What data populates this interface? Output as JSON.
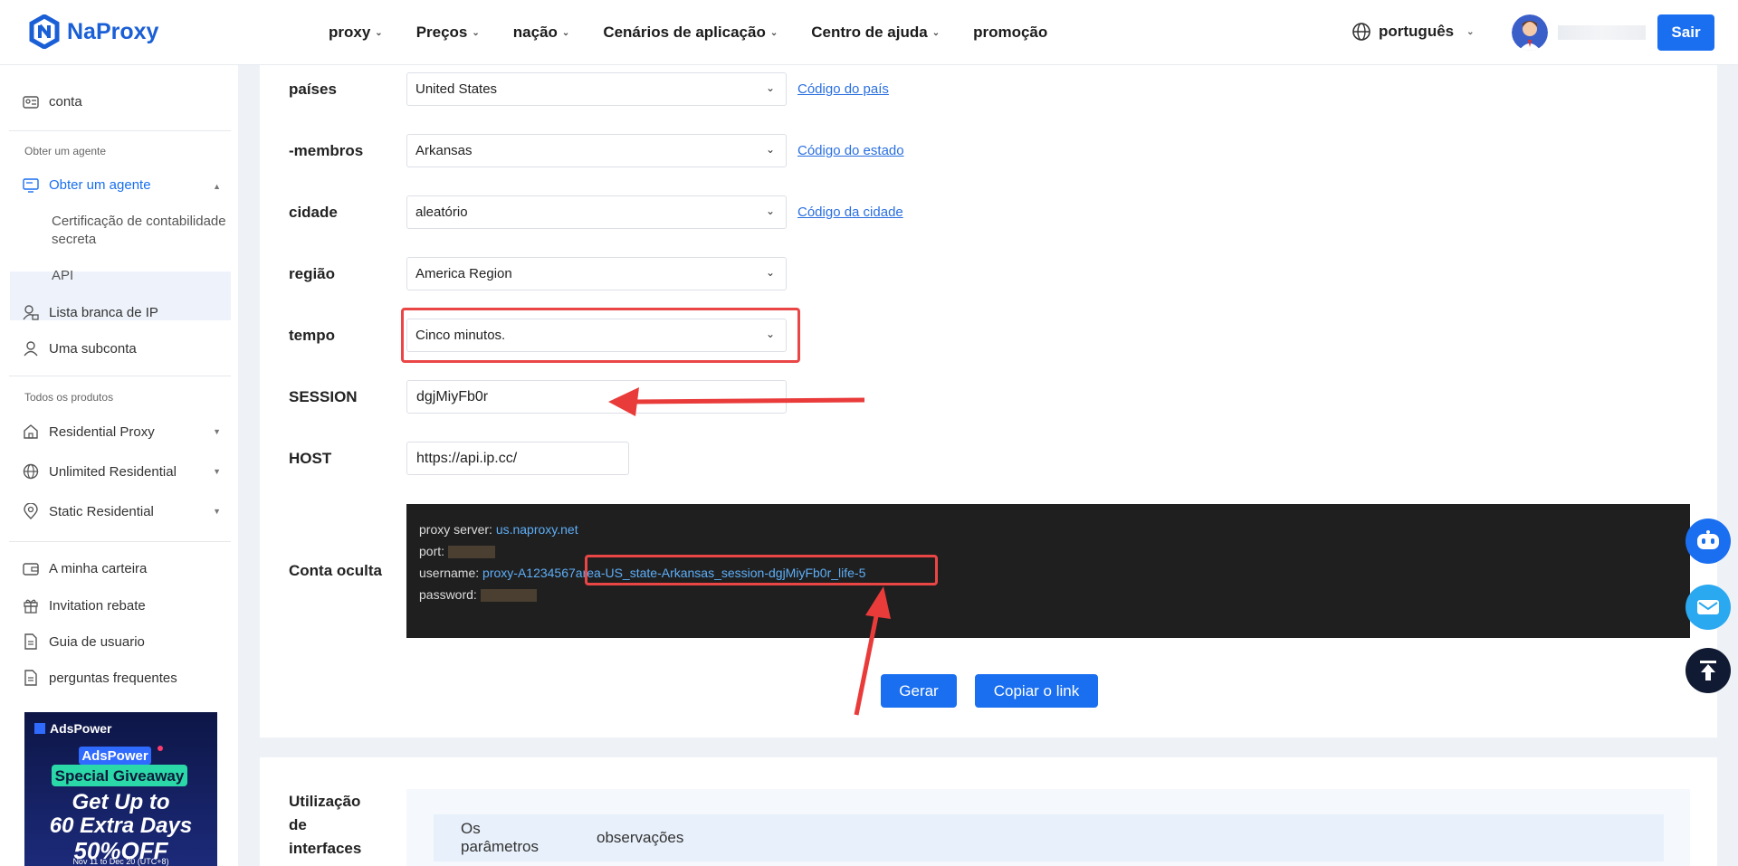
{
  "header": {
    "brand": "NaProxy",
    "nav": [
      "proxy",
      "Preços",
      "nação",
      "Cenários de aplicação",
      "Centro de ajuda",
      "promoção"
    ],
    "nav_has_dropdown": [
      true,
      true,
      true,
      true,
      true,
      false
    ],
    "language": "português",
    "logout_label": "Sair"
  },
  "sidebar": {
    "account": "conta",
    "section_agent": "Obter um agente",
    "agent_menu": "Obter um agente",
    "agent_sub_1": "Certificação de contabilidade secreta",
    "agent_sub_2": "API",
    "ip_whitelist": "Lista branca de IP",
    "subaccount": "Uma subconta",
    "section_products": "Todos os produtos",
    "products": [
      "Residential Proxy",
      "Unlimited Residential",
      "Static Residential"
    ],
    "wallet": "A minha carteira",
    "invitation": "Invitation rebate",
    "guide": "Guia de usuario",
    "faq": "perguntas frequentes"
  },
  "ad": {
    "brand": "AdsPower",
    "badge": "AdsPower",
    "giveaway": "Special Giveaway",
    "headline_1": "Get Up to",
    "headline_2": "60 Extra Days",
    "discount": "50%OFF",
    "dates": "Nov 11 to Dec 20 (UTC+8)"
  },
  "form": {
    "country_label": "países",
    "country_value": "United States",
    "country_link": "Código do país",
    "state_label": "-membros",
    "state_value": "Arkansas",
    "state_link": "Código do estado",
    "city_label": "cidade",
    "city_value": "aleatório",
    "city_link": "Código da cidade",
    "region_label": "região",
    "region_value": "America Region",
    "time_label": "tempo",
    "time_value": "Cinco minutos.",
    "session_label": "SESSION",
    "session_value": "dgjMiyFb0r",
    "host_label": "HOST",
    "host_value": "https://api.ip.cc/"
  },
  "hidden_account": {
    "label": "Conta oculta",
    "server_key": "proxy server:",
    "server_value": "us.naproxy.net",
    "port_key": "port:",
    "username_key": "username:",
    "username_prefix": "proxy-A1234567",
    "username_suffix": "area-US_state-Arkansas_session-dgjMiyFb0r_life-5",
    "password_key": "password:"
  },
  "actions": {
    "generate": "Gerar",
    "copy_link": "Copiar o link"
  },
  "usage": {
    "label_1": "Utilização",
    "label_2": "de",
    "label_3": "interfaces",
    "col_params_1": "Os",
    "col_params_2": "parâmetros",
    "col_notes": "observações"
  },
  "colors": {
    "primary": "#1a6ff0",
    "highlight": "#ea4646",
    "panel": "#1f1f1f",
    "link": "#2a6fe0"
  }
}
